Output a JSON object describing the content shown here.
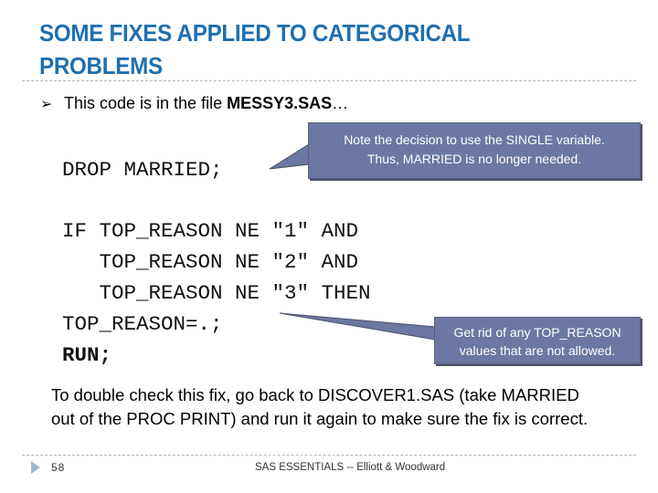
{
  "slide": {
    "title": "SOME FIXES APPLIED TO CATEGORICAL PROBLEMS",
    "bullet": {
      "icon": "arrow-bullet-icon",
      "text_prefix": "This code is in the file ",
      "file_name": "MESSY3.SAS",
      "text_suffix": "…"
    },
    "code": {
      "drop_line": "DROP MARRIED;",
      "if_lines": [
        "IF TOP_REASON NE \"1\" AND",
        "   TOP_REASON NE \"2\" AND",
        "   TOP_REASON NE \"3\" THEN",
        "TOP_REASON=.;"
      ],
      "run_line": "RUN;"
    },
    "callouts": [
      {
        "lines": [
          "Note the decision to use the SINGLE variable.",
          "Thus, MARRIED is no longer needed."
        ]
      },
      {
        "lines": [
          "Get rid of any TOP_REASON",
          "values that are not allowed."
        ]
      }
    ],
    "note": "To double check this fix, go back to DISCOVER1.SAS (take MARRIED out of the PROC PRINT) and run it again to make sure the fix is correct.",
    "footer": {
      "page_number": "58",
      "text": "SAS ESSENTIALS -- Elliott & Woodward"
    },
    "colors": {
      "title": "#1f6fb0",
      "callout_fill": "#6c78a3",
      "callout_border": "#4a4f68",
      "footer_triangle": "#a3b8cf"
    }
  }
}
